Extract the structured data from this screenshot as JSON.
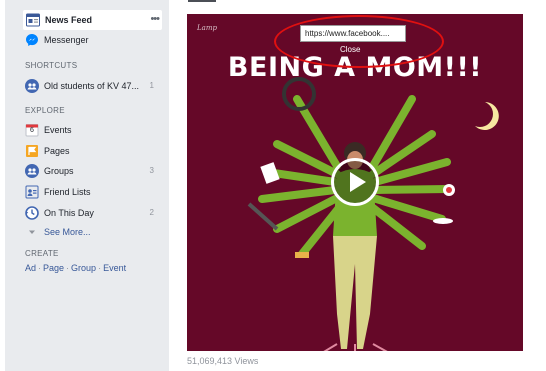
{
  "sidebar": {
    "news_feed": "News Feed",
    "news_feed_more": "•••",
    "messenger": "Messenger",
    "shortcuts_header": "SHORTCUTS",
    "shortcut_item": "Old students of KV 47...",
    "shortcut_count": "1",
    "explore_header": "EXPLORE",
    "explore": [
      {
        "label": "Events",
        "icon": "calendar-icon",
        "count": ""
      },
      {
        "label": "Pages",
        "icon": "flag-icon",
        "count": ""
      },
      {
        "label": "Groups",
        "icon": "groups-icon",
        "count": "3"
      },
      {
        "label": "Friend Lists",
        "icon": "friend-list-icon",
        "count": ""
      },
      {
        "label": "On This Day",
        "icon": "on-this-day-icon",
        "count": "2"
      }
    ],
    "events_date": "6",
    "see_more": "See More...",
    "create_header": "CREATE",
    "create_links": [
      "Ad",
      "Page",
      "Group",
      "Event"
    ],
    "create_sep": "·"
  },
  "video": {
    "title_text": "BEING A MOM!!!",
    "views": "51,069,413 Views"
  },
  "tooltip": {
    "url": "https://www.facebook....",
    "close_label": "Close"
  },
  "colors": {
    "accent": "#3b5998",
    "link": "#385898",
    "video_bg": "#650828",
    "annotation_red": "#e01010"
  }
}
